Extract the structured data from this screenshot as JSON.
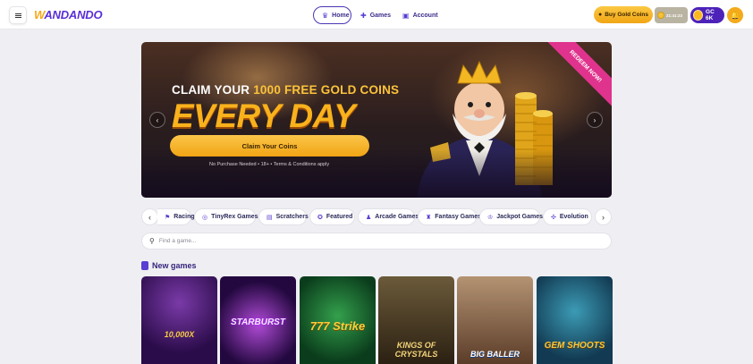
{
  "header": {
    "logo_prefix": "W",
    "logo_rest": "ANDANDO",
    "nav": [
      {
        "label": "Home",
        "icon": "crown-icon",
        "active": true
      },
      {
        "label": "Games",
        "icon": "gamepad-icon",
        "active": false
      },
      {
        "label": "Account",
        "icon": "id-card-icon",
        "active": false
      }
    ],
    "buy_label": "Buy Gold Coins",
    "timer_line1": "21:41:23",
    "timer_line2": "",
    "balance": "GC 6K"
  },
  "hero": {
    "claim_prefix": "CLAIM YOUR ",
    "claim_highlight": "1000 FREE GOLD COINS",
    "headline": "EVERY DAY",
    "button": "Claim Your Coins",
    "fine_print": "No Purchase Needed • 18+ • Terms & Conditions apply",
    "ribbon": "REDEEM NOW!"
  },
  "categories": [
    {
      "label": "Racing",
      "icon": "flag-icon"
    },
    {
      "label": "TinyRex Games",
      "icon": "globe-icon"
    },
    {
      "label": "Scratchers",
      "icon": "ticket-icon"
    },
    {
      "label": "Featured",
      "icon": "star-icon"
    },
    {
      "label": "Arcade Games",
      "icon": "joystick-icon"
    },
    {
      "label": "Fantasy Games",
      "icon": "castle-icon"
    },
    {
      "label": "Jackpot Games",
      "icon": "trophy-icon"
    },
    {
      "label": "Evolution",
      "icon": "dna-icon"
    }
  ],
  "search": {
    "placeholder": "Find a game..."
  },
  "new_games": {
    "title": "New games",
    "tiles": [
      {
        "name": "10,000X",
        "color": "#3a1460"
      },
      {
        "name": "STARBURST",
        "color": "#2a1048"
      },
      {
        "name": "777 Strike",
        "color": "#0f5a2a"
      },
      {
        "name": "KINGS OF CRYSTALS",
        "color": "#3b2b1a"
      },
      {
        "name": "BIG BALLER",
        "color": "#6a4a34"
      },
      {
        "name": "GEM SHOOTS",
        "color": "#1d5870"
      }
    ]
  },
  "colors": {
    "brand": "#5a2fd6",
    "accent": "#f7a919",
    "pink": "#e0338d"
  }
}
